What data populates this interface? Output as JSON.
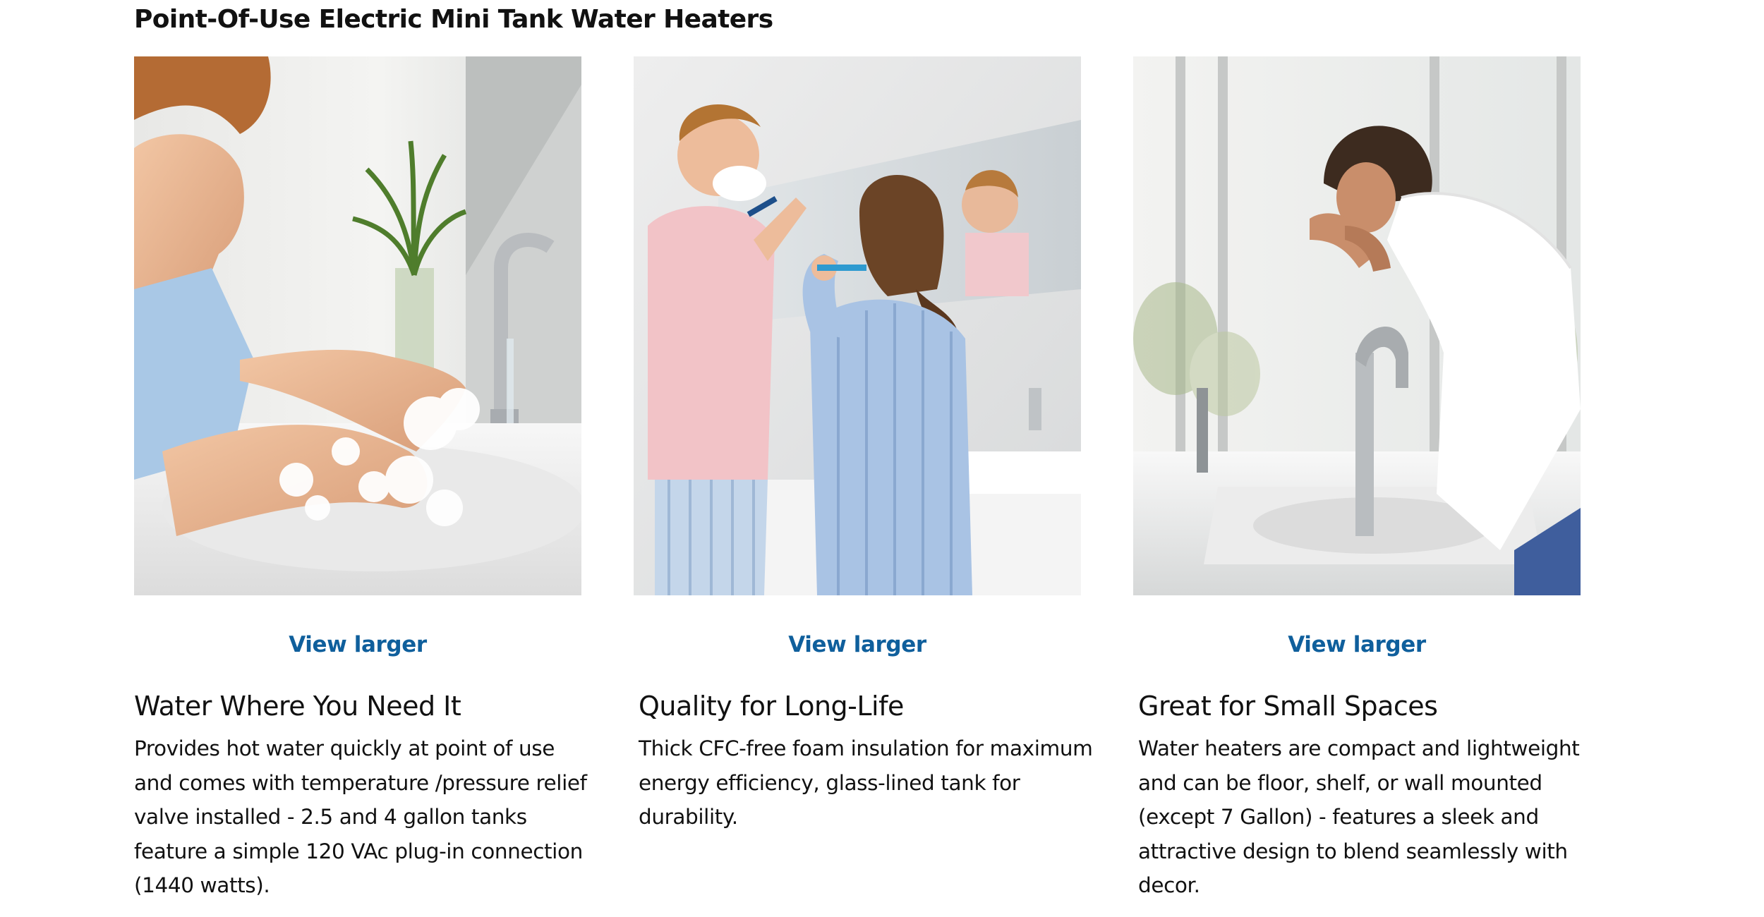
{
  "section": {
    "title": "Point-Of-Use Electric Mini Tank Water Heaters"
  },
  "cards": [
    {
      "image_alt": "Child washing soapy hands at a bathroom faucet",
      "view_larger_label": "View larger",
      "title": "Water Where You Need It",
      "text": "Provides hot water quickly at point of use and comes with temperature /pressure relief valve installed - 2.5 and 4 gallon tanks feature a simple 120 VAc plug-in connection (1440 watts)."
    },
    {
      "image_alt": "Couple shaving and brushing teeth in front of a bathroom mirror",
      "view_larger_label": "View larger",
      "title": "Quality for Long-Life",
      "text": "Thick CFC-free foam insulation for maximum energy efficiency, glass-lined tank for durability."
    },
    {
      "image_alt": "Woman splashing water on her face at a bathroom sink",
      "view_larger_label": "View larger",
      "title": "Great for Small Spaces",
      "text": "Water heaters are compact and lightweight and can be floor, shelf, or wall mounted (except 7 Gallon) - features a sleek and attractive design to blend seamlessly with decor."
    }
  ],
  "colors": {
    "link": "#0f5f9c",
    "text": "#111111",
    "background": "#ffffff"
  }
}
